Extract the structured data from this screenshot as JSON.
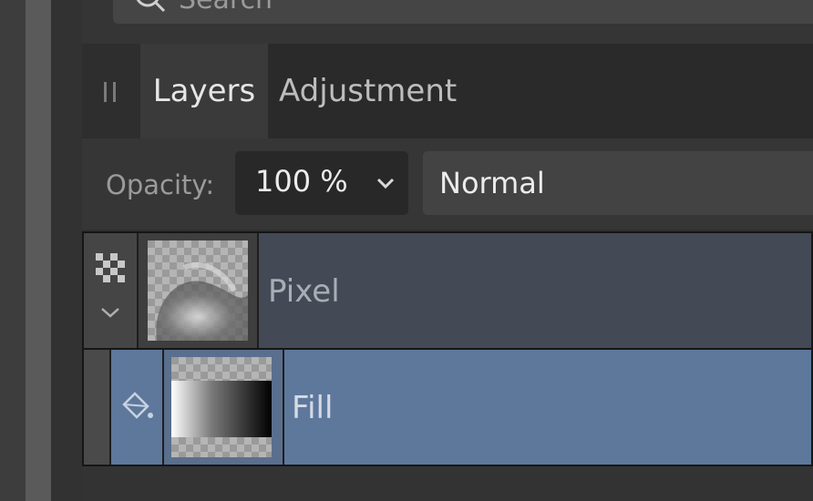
{
  "search": {
    "placeholder": "Search"
  },
  "tabs": [
    {
      "label": "Layers",
      "active": true
    },
    {
      "label": "Adjustment",
      "active": false
    }
  ],
  "opacity": {
    "label": "Opacity:",
    "value": "100 %"
  },
  "blend_mode": {
    "value": "Normal"
  },
  "layers": [
    {
      "name": "Pixel",
      "type": "pixel",
      "selected": false
    },
    {
      "name": "Fill",
      "type": "fill",
      "selected": true
    }
  ],
  "icons": [
    "search-icon",
    "panel-grip-icon",
    "chevron-down-icon",
    "checkerboard-icon",
    "fill-bucket-icon"
  ],
  "colors": {
    "panel_bg": "#2f2f2f",
    "selected_layer": "#5e789c",
    "parent_layer": "#434a55"
  }
}
